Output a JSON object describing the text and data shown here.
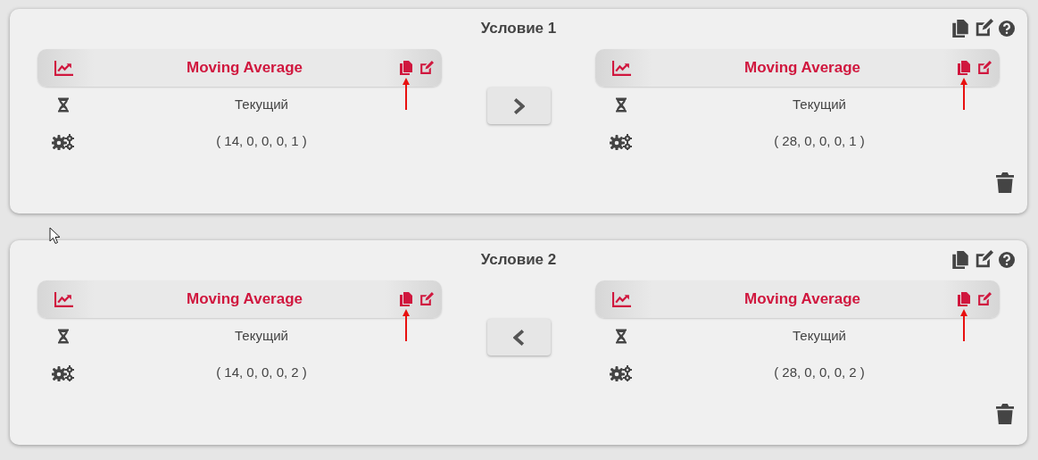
{
  "conditions": [
    {
      "title": "Условие 1",
      "forward": true,
      "indicators": [
        {
          "name": "Moving Average",
          "period": "Текущий",
          "params": "( 14, 0, 0, 0, 1 )",
          "highlighted": true
        },
        {
          "name": "Moving Average",
          "period": "Текущий",
          "params": "( 28, 0, 0, 0, 1 )",
          "highlighted": true
        }
      ]
    },
    {
      "title": "Условие 2",
      "forward": false,
      "indicators": [
        {
          "name": "Moving Average",
          "period": "Текущий",
          "params": "( 14, 0, 0, 0, 2 )",
          "highlighted": true
        },
        {
          "name": "Moving Average",
          "period": "Текущий",
          "params": "( 28, 0, 0, 0, 2 )",
          "highlighted": true
        }
      ]
    }
  ]
}
